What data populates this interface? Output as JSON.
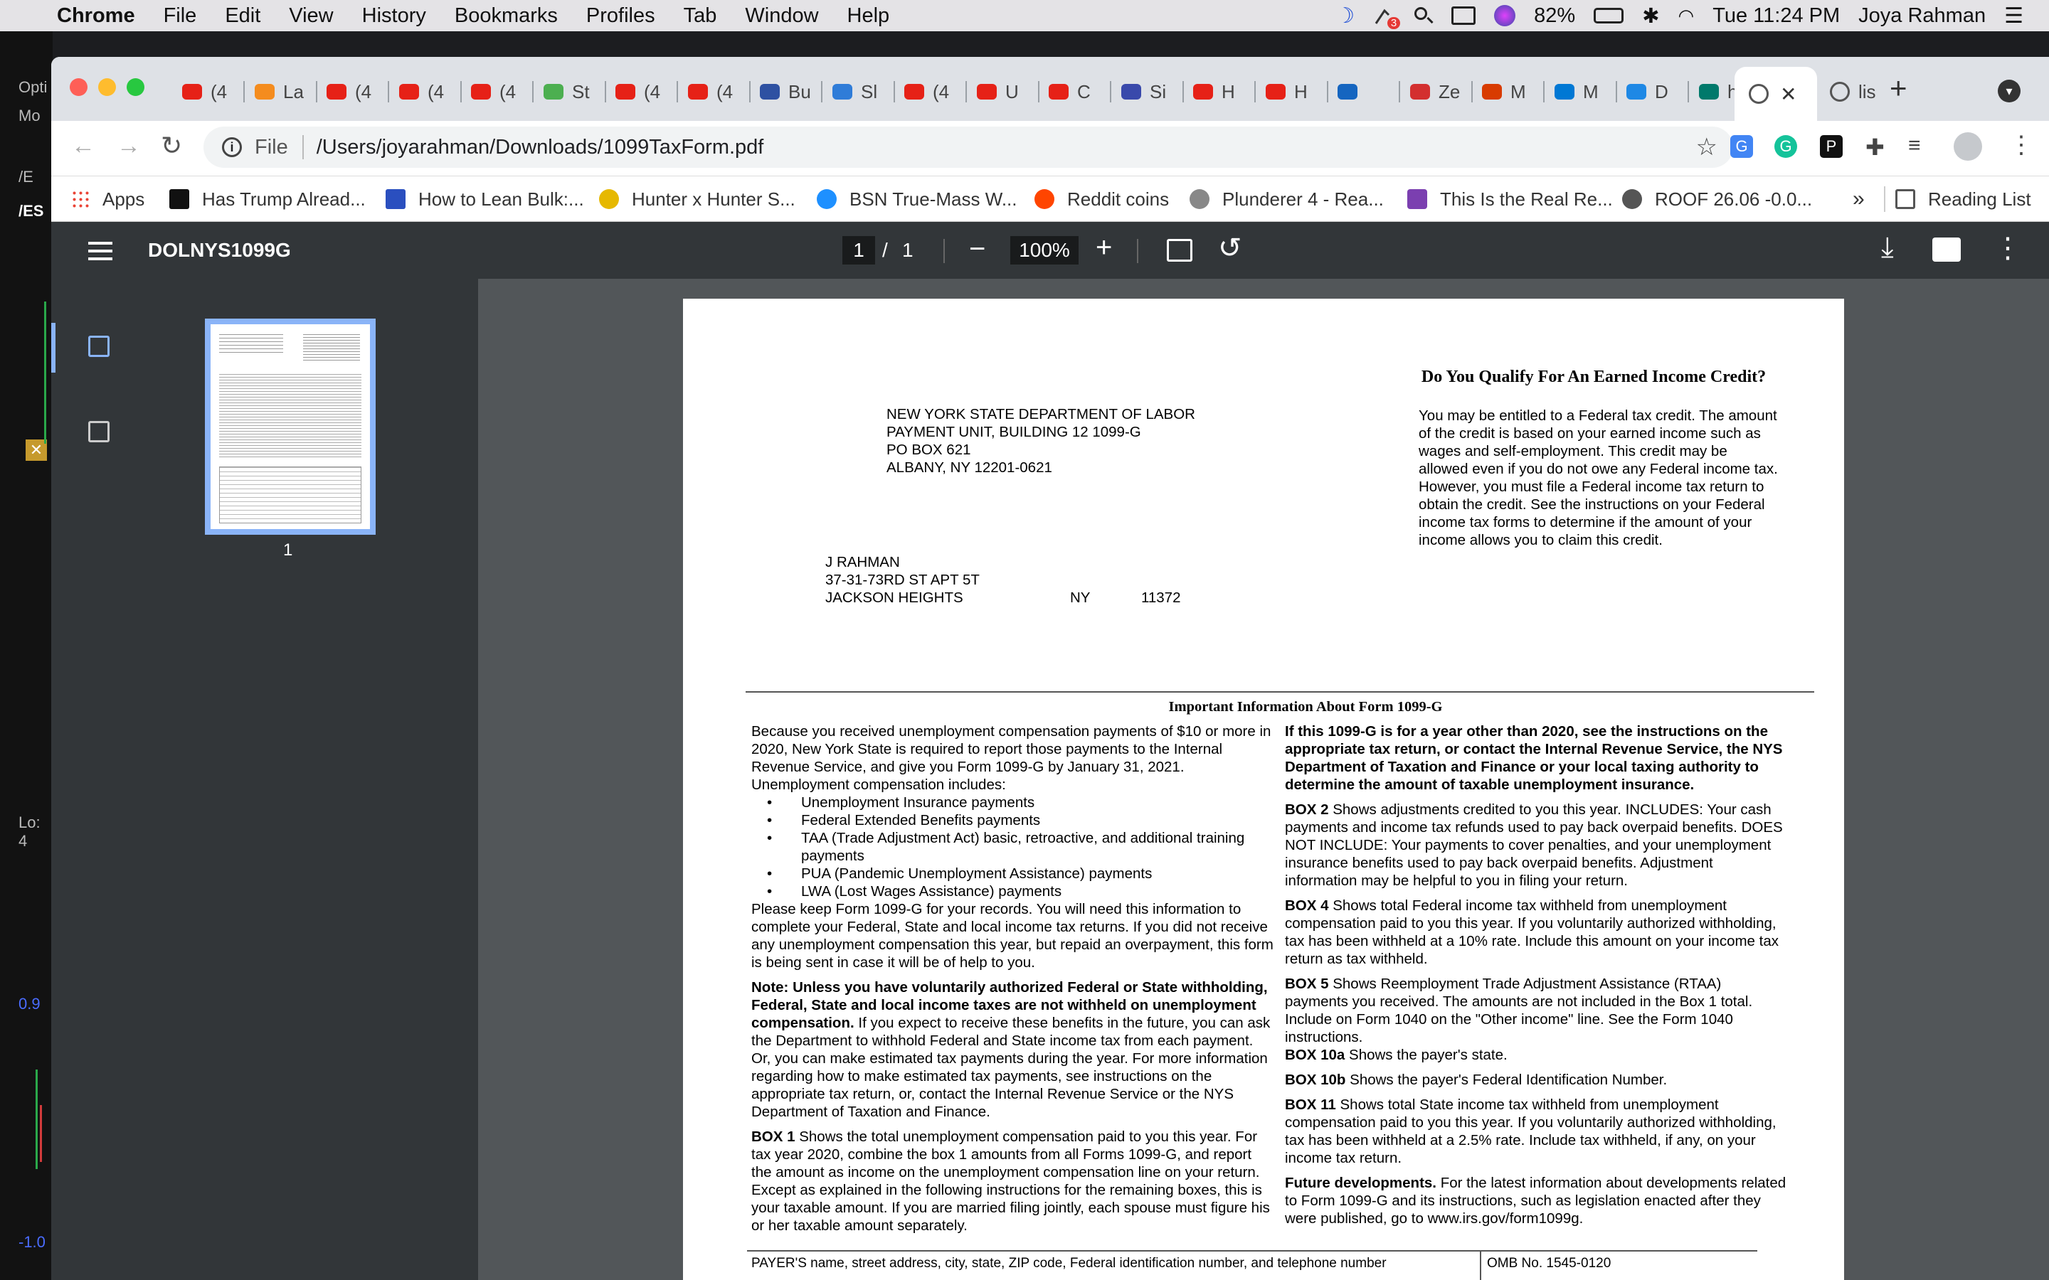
{
  "menubar": {
    "app": "Chrome",
    "items": [
      "File",
      "Edit",
      "View",
      "History",
      "Bookmarks",
      "Profiles",
      "Tab",
      "Window",
      "Help"
    ],
    "battery": "82%",
    "clock": "Tue 11:24 PM",
    "user": "Joya Rahman",
    "notif_count": "3"
  },
  "background_app": {
    "labels": [
      "Opti",
      "Mo",
      "/E",
      "/ES",
      "Lo: 4",
      "0.9",
      "-1.0"
    ]
  },
  "tabs": [
    {
      "label": "(4",
      "icon": "youtube-icon",
      "color": "#e62117"
    },
    {
      "label": "La",
      "icon": "circle-icon",
      "color": "#f48c1e"
    },
    {
      "label": "(4",
      "icon": "youtube-icon",
      "color": "#e62117"
    },
    {
      "label": "(4",
      "icon": "youtube-icon",
      "color": "#e62117"
    },
    {
      "label": "(4",
      "icon": "youtube-icon",
      "color": "#e62117"
    },
    {
      "label": "St",
      "icon": "flask-icon",
      "color": "#4caf50"
    },
    {
      "label": "(4",
      "icon": "youtube-icon",
      "color": "#e62117"
    },
    {
      "label": "(4",
      "icon": "youtube-icon",
      "color": "#e62117"
    },
    {
      "label": "Bu",
      "icon": "mal-icon",
      "color": "#2e51a2"
    },
    {
      "label": "Sl",
      "icon": "cloud-icon",
      "color": "#2f7cd8"
    },
    {
      "label": "(4",
      "icon": "youtube-icon",
      "color": "#e62117"
    },
    {
      "label": "U",
      "icon": "youtube-icon",
      "color": "#e62117"
    },
    {
      "label": "C",
      "icon": "youtube-icon",
      "color": "#e62117"
    },
    {
      "label": "Si",
      "icon": "book-icon",
      "color": "#3949ab"
    },
    {
      "label": "H",
      "icon": "youtube-icon",
      "color": "#e62117"
    },
    {
      "label": "H",
      "icon": "youtube-icon",
      "color": "#e62117"
    },
    {
      "label": "",
      "icon": "badge-icon",
      "color": "#1565c0"
    },
    {
      "label": "Ze",
      "icon": "plus-icon",
      "color": "#d32f2f"
    },
    {
      "label": "M",
      "icon": "office-icon",
      "color": "#d83b01"
    },
    {
      "label": "M",
      "icon": "outlook-icon",
      "color": "#0078d4"
    },
    {
      "label": "D",
      "icon": "diamond-icon",
      "color": "#1e88e5"
    },
    {
      "label": "ht",
      "icon": "chart-icon",
      "color": "#00796b"
    }
  ],
  "active_tab": {
    "close": "✕"
  },
  "last_tab": {
    "label": "lis"
  },
  "new_tab": "+",
  "toolbar": {
    "file_label": "File",
    "url": "/Users/joyarahman/Downloads/1099TaxForm.pdf"
  },
  "bookmarks": {
    "apps": "Apps",
    "items": [
      "Has Trump Alread...",
      "How to Lean Bulk:...",
      "Hunter x Hunter S...",
      "BSN True-Mass W...",
      "Reddit coins",
      "Plunderer 4 - Rea...",
      "This Is the Real Re...",
      "ROOF 26.06 -0.0..."
    ],
    "overflow": "»",
    "reading_list": "Reading List"
  },
  "pdf": {
    "title": "DOLNYS1099G",
    "page_current": "1",
    "page_sep": "/",
    "page_total": "1",
    "zoom": "100%",
    "thumb_label": "1"
  },
  "doc": {
    "sender": [
      "NEW YORK STATE DEPARTMENT OF LABOR",
      "PAYMENT UNIT, BUILDING 12 1099-G",
      "PO BOX 621",
      "ALBANY, NY 12201-0621"
    ],
    "recipient": {
      "name": "J RAHMAN",
      "street": "37-31-73RD ST APT 5T",
      "city": "JACKSON HEIGHTS",
      "state": "NY",
      "zip": "11372"
    },
    "eitc_title": "Do You Qualify For An Earned Income Credit?",
    "eitc_body": "You may be entitled to a Federal tax credit. The amount of the credit is based on your earned income such as wages and self-employment. This credit may be allowed even if you do not owe any Federal income tax. However, you must file a Federal income tax return to obtain the credit. See the instructions on your Federal income tax forms to determine if the amount of your income allows you to claim this credit.",
    "info_title": "Important Information About Form 1099-G",
    "left_intro": "Because you received unemployment compensation payments of $10 or more in 2020, New York State is required to report those payments to the Internal Revenue Service, and give you Form 1099-G by January 31, 2021. Unemployment compensation includes:",
    "bullet_mark": "•",
    "bullets": [
      "Unemployment Insurance payments",
      "Federal Extended Benefits payments",
      "TAA (Trade Adjustment Act) basic, retroactive, and additional training payments",
      "PUA (Pandemic Unemployment Assistance) payments",
      "LWA (Lost Wages Assistance) payments"
    ],
    "keep": "Please keep Form 1099-G for your records. You will need this information to complete your Federal, State and local income tax returns. If you did not receive any unemployment compensation this year, but repaid an overpayment, this form is being sent in case it will be of help to you.",
    "note_bold": "Note: Unless you have voluntarily authorized Federal or State withholding,",
    "note_bold2": "Federal, State and local income taxes are not withheld on unemployment compensation.",
    "note_rest": " If you expect to receive these benefits in the future, you can ask the Department to withhold Federal and State income tax from each payment. Or, you can make estimated tax payments during the year. For more information regarding how to make estimated tax payments, see instructions on the appropriate tax return, or, contact the Internal Revenue Service or the NYS Department of Taxation and Finance.",
    "box1_label": "BOX 1",
    "box1_text": " Shows the total unemployment compensation paid to you this year. For tax year 2020, combine the box 1 amounts from all Forms 1099-G, and report the amount as income on the unemployment compensation line on your return. Except as explained in the following instructions for the remaining boxes, this is your taxable amount. If you are married filing jointly, each spouse must figure his or her taxable amount separately.",
    "right_bold": "If this 1099-G is for a year other than 2020, see the instructions on the appropriate tax return, or contact the Internal Revenue Service, the NYS Department of Taxation and Finance or your local taxing authority to determine the amount of taxable unemployment insurance.",
    "box2_label": "BOX 2",
    "box2_text": " Shows adjustments credited to you this year. INCLUDES: Your cash payments and income tax refunds used to pay back overpaid benefits. DOES NOT INCLUDE: Your payments to cover penalties, and your unemployment insurance benefits used to pay back overpaid benefits. Adjustment information may be helpful to you in filing your return.",
    "box4_label": "BOX 4",
    "box4_text": " Shows total Federal income tax withheld from unemployment compensation paid to you this year. If you voluntarily authorized withholding, tax has been withheld at a 10% rate. Include this amount on your income tax return as tax withheld.",
    "box5_label": "BOX 5",
    "box5_text": " Shows Reemployment Trade Adjustment Assistance (RTAA) payments you received. The amounts are not included in the Box 1 total. Include on Form 1040 on the \"Other income\" line. See the Form 1040 instructions.",
    "box10a_label": "BOX 10a",
    "box10a_text": " Shows the payer's state.",
    "box10b_label": "BOX 10b",
    "box10b_text": " Shows the payer's Federal Identification Number.",
    "box11_label": "BOX 11",
    "box11_text": " Shows total State income tax withheld from unemployment compensation paid to you this year. If you voluntarily authorized withholding, tax has been withheld at a 2.5% rate. Include tax withheld, if any, on your income tax return.",
    "future_label": "Future developments.",
    "future_text": " For the latest information about developments related to Form 1099-G and its instructions, such as legislation enacted after they were published, go to www.irs.gov/form1099g.",
    "payer_header": "PAYER'S name, street address, city, state, ZIP code, Federal identification number, and telephone number",
    "omb": "OMB No. 1545-0120"
  }
}
